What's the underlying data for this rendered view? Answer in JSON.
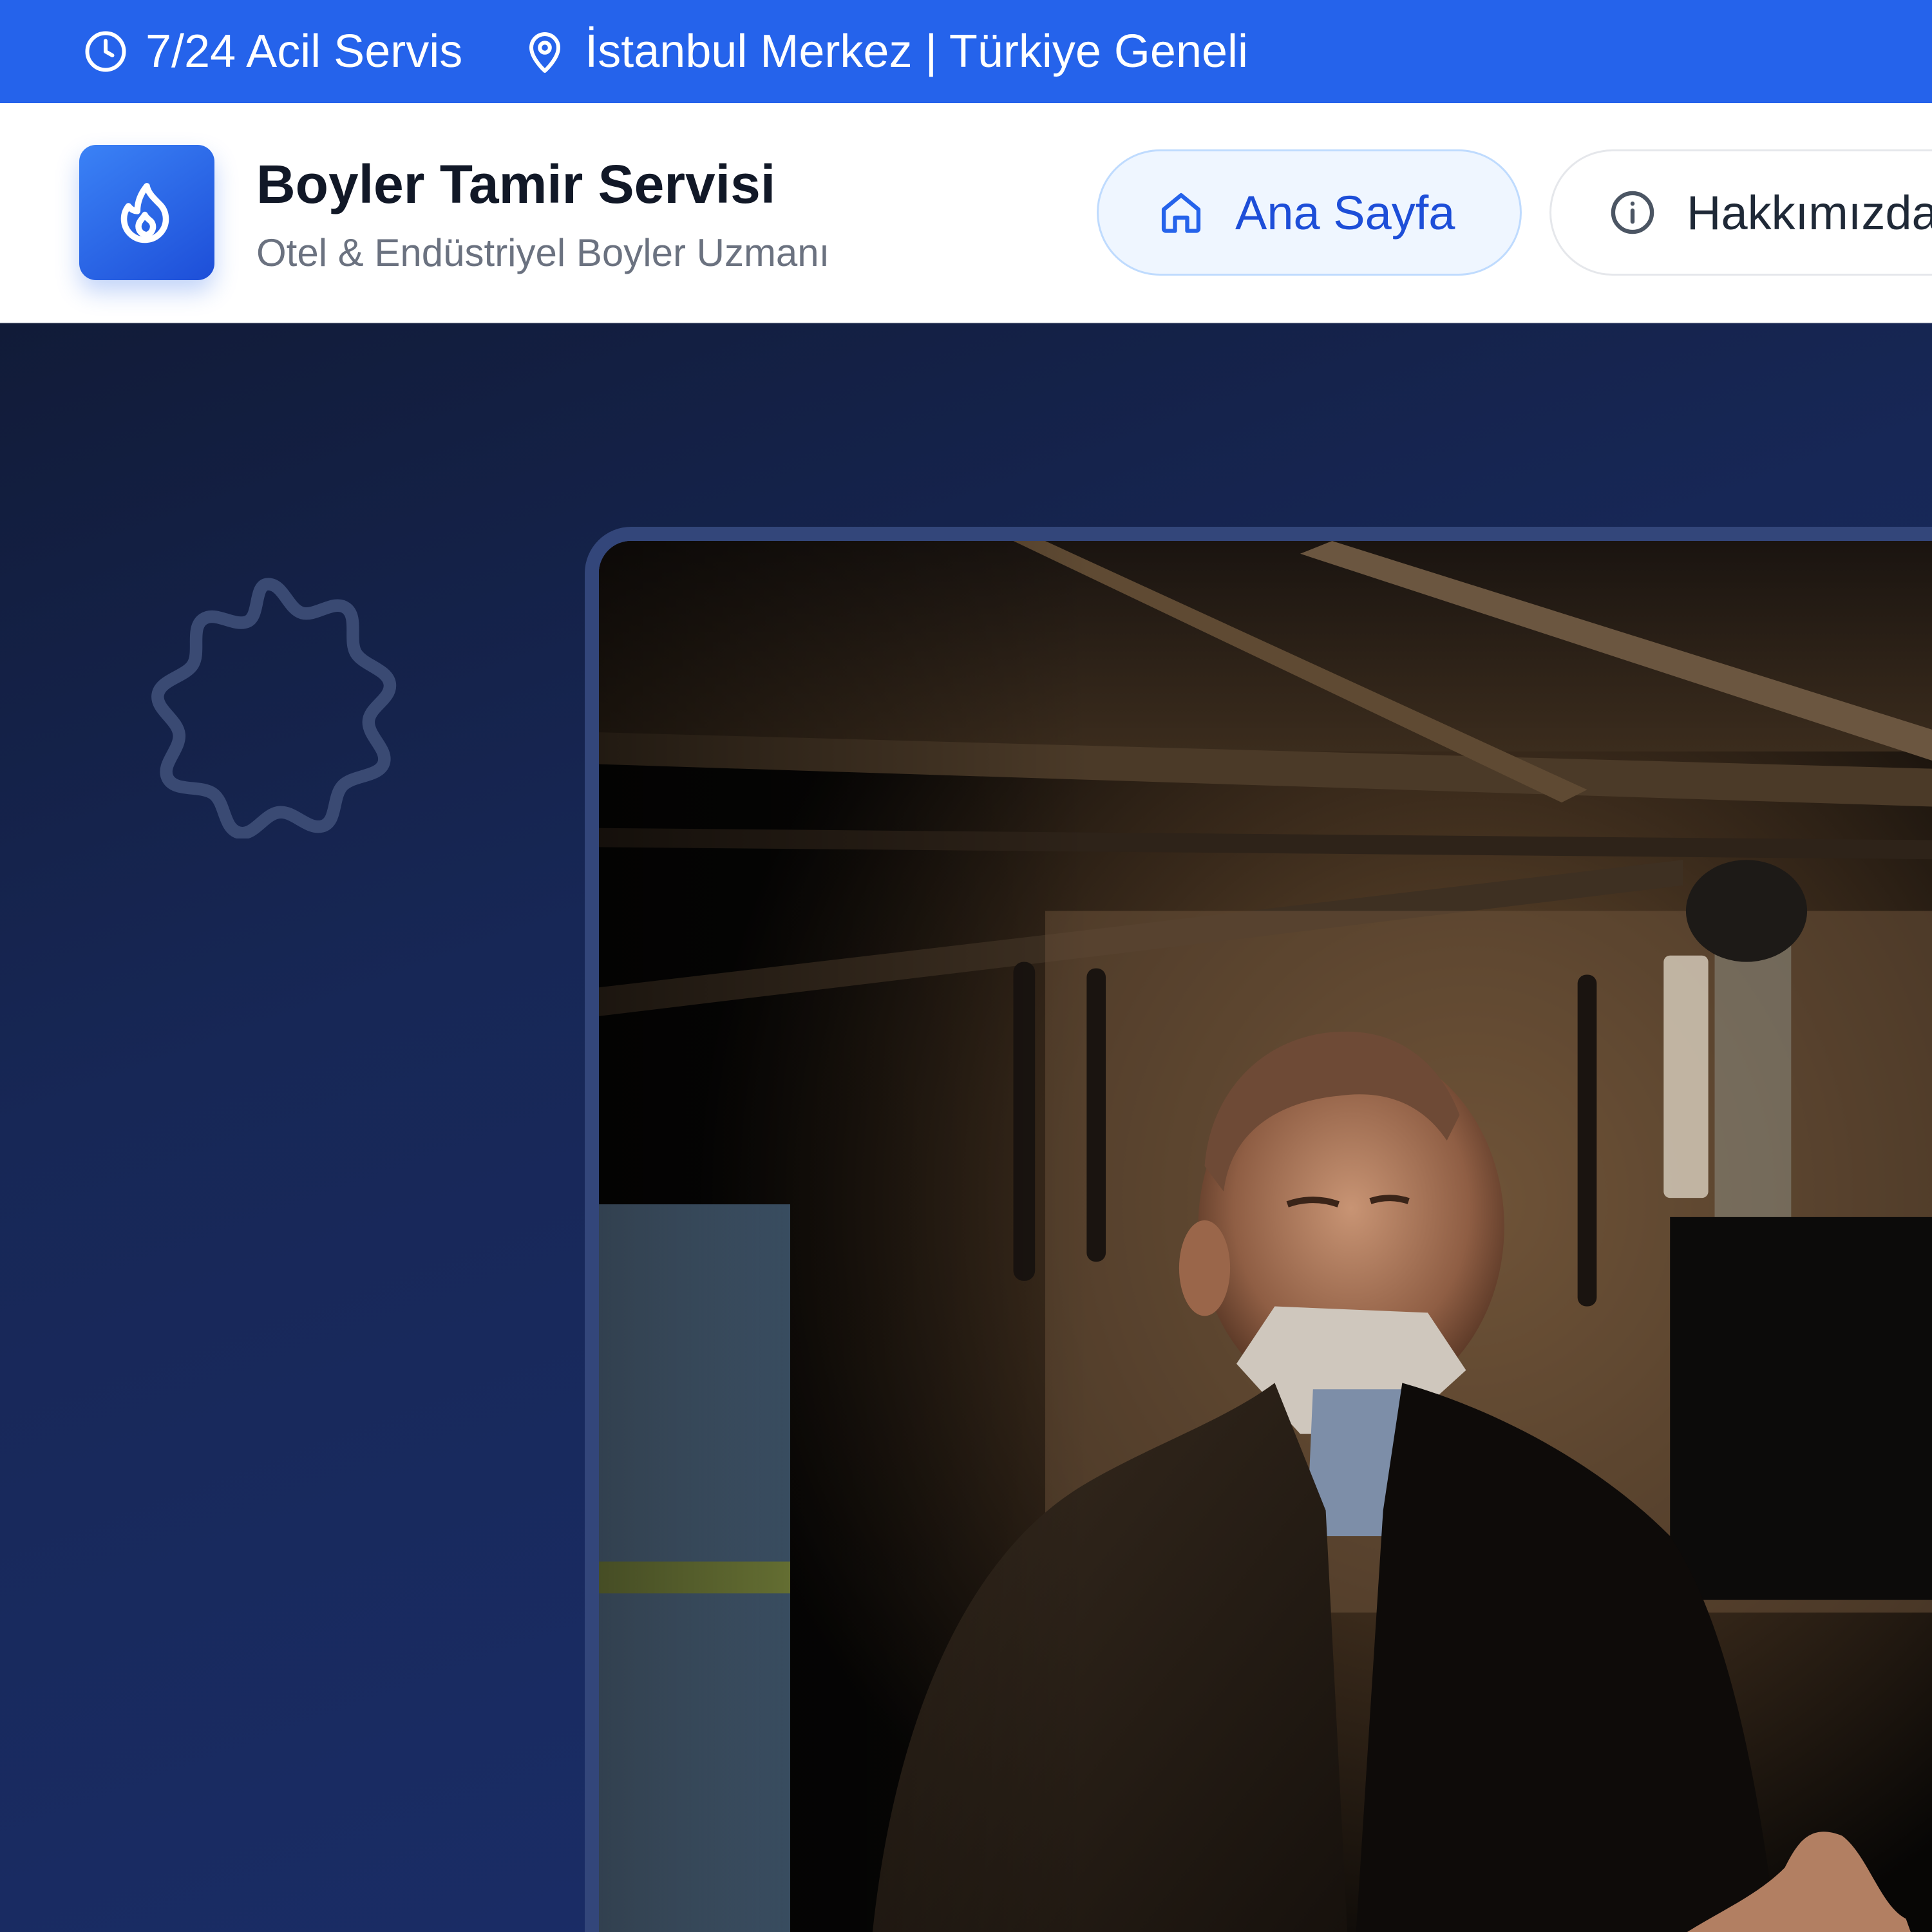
{
  "topbar": {
    "service_hours": "7/24 Acil Servis",
    "location": "İstanbul Merkez | Türkiye Geneli",
    "icons": [
      "clock-icon",
      "map-pin-icon"
    ]
  },
  "header": {
    "logo_icon": "flame-icon",
    "brand_title": "Boyler Tamir Servisi",
    "brand_subtitle": "Otel & Endüstriyel Boyler Uzmanı",
    "nav": [
      {
        "label": "Ana Sayfa",
        "icon": "home-icon",
        "active": true
      },
      {
        "label": "Hakkımızda",
        "icon": "info-icon",
        "active": false
      }
    ]
  },
  "hero": {
    "decor_icon": "gear-outline-icon",
    "photo": "technician-in-boiler-room"
  },
  "colors": {
    "primary": "#2563eb",
    "primary_dark": "#1d4ed8",
    "hero_bg": "#17285a",
    "text_dark": "#111827",
    "text_muted": "#6b7280",
    "pill_active_bg": "#eff6ff"
  }
}
